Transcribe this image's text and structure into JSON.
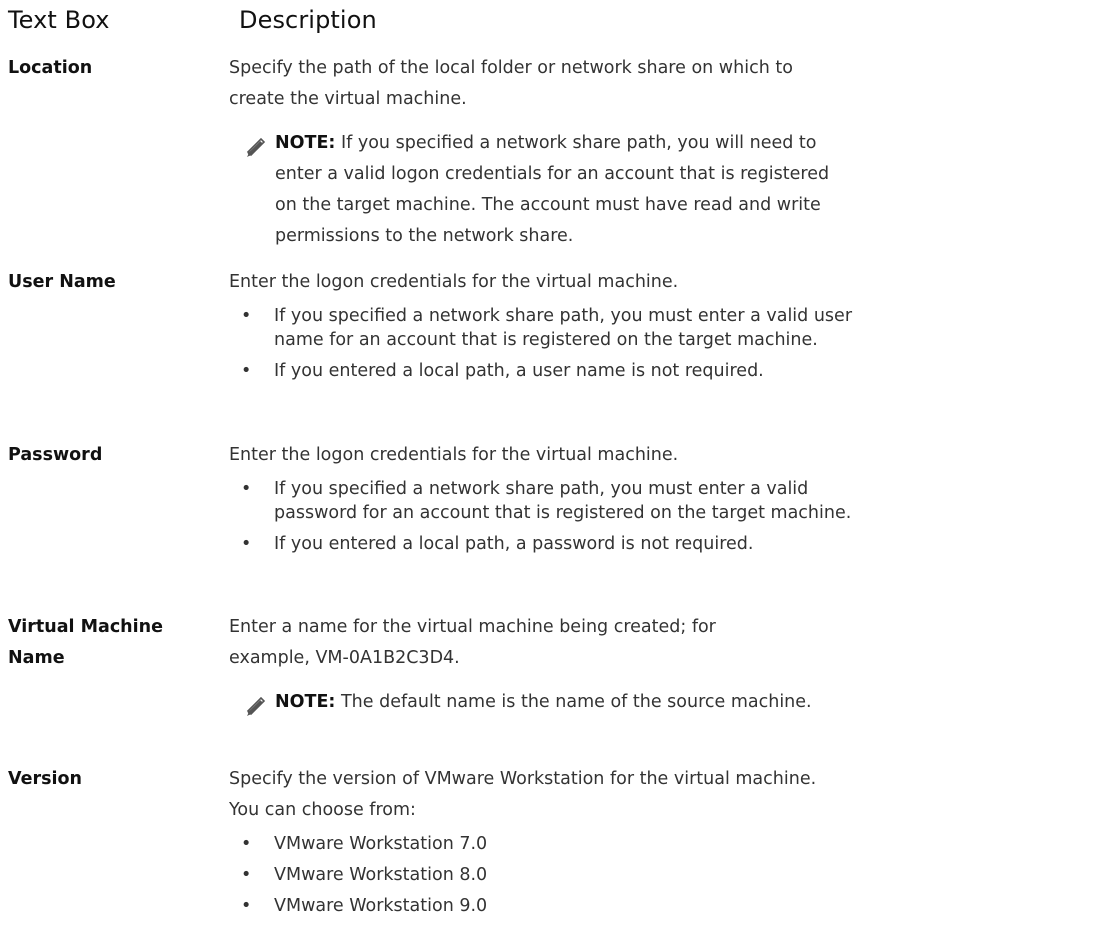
{
  "header": {
    "col1": "Text Box",
    "col2": "Description"
  },
  "rows": [
    {
      "term": "Location",
      "description": "Specify the path of the local folder or network share on which to create the virtual machine.",
      "note_label": "NOTE:",
      "note_text": " If you specified a network share path, you will need to enter a valid logon credentials for an account that is registered on the target machine. The account must have read and write permissions to the network share."
    },
    {
      "term": "User Name",
      "description": "Enter the logon credentials for the virtual machine.",
      "bullets": [
        "If you specified a network share path, you must enter a valid user name for an account that is registered on the target machine.",
        "If you entered a local path, a user name is not required."
      ]
    },
    {
      "term": "Password",
      "description": "Enter the logon credentials for the virtual machine.",
      "bullets": [
        "If you specified a network share path, you must enter a valid password for an account that is registered on the target machine.",
        "If you entered a local path, a password is not required."
      ]
    },
    {
      "term": "Virtual Machine Name",
      "description": "Enter a name for the virtual machine being created; for example, VM-0A1B2C3D4.",
      "note_label": "NOTE:",
      "note_text": " The default name is the name of the source machine."
    },
    {
      "term": "Version",
      "description": "Specify the version of VMware Workstation for the virtual machine. You can choose from:",
      "bullets": [
        "VMware Workstation 7.0",
        "VMware Workstation 8.0",
        "VMware Workstation 9.0"
      ]
    }
  ],
  "bullet_glyph": "•",
  "icon": "note-pencil-icon"
}
